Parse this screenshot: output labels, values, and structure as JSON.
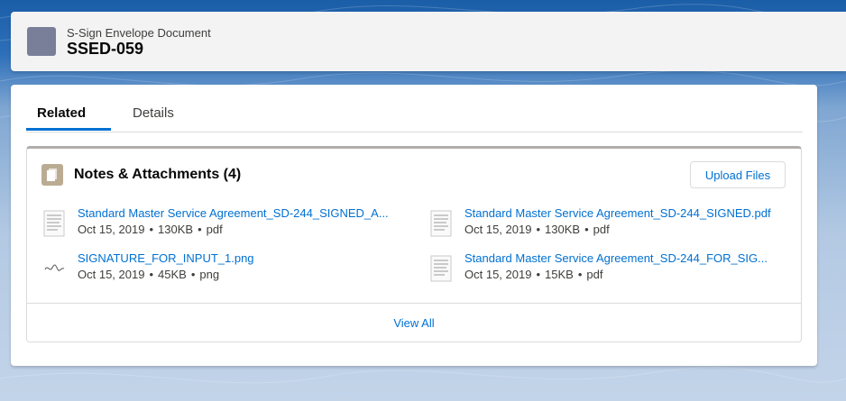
{
  "header": {
    "object_label": "S-Sign Envelope Document",
    "record_name": "SSED-059"
  },
  "tabs": [
    {
      "label": "Related",
      "active": true
    },
    {
      "label": "Details",
      "active": false
    }
  ],
  "notes_attachments": {
    "title": "Notes & Attachments (4)",
    "upload_label": "Upload Files",
    "view_all_label": "View All",
    "files": [
      {
        "name": "Standard Master Service Agreement_SD-244_SIGNED_A...",
        "date": "Oct 15, 2019",
        "size": "130KB",
        "type": "pdf",
        "thumb_icon": "pdf-document-thumbnail"
      },
      {
        "name": "Standard Master Service Agreement_SD-244_SIGNED.pdf",
        "date": "Oct 15, 2019",
        "size": "130KB",
        "type": "pdf",
        "thumb_icon": "pdf-document-thumbnail"
      },
      {
        "name": "SIGNATURE_FOR_INPUT_1.png",
        "date": "Oct 15, 2019",
        "size": "45KB",
        "type": "png",
        "thumb_icon": "signature-image-thumbnail"
      },
      {
        "name": "Standard Master Service Agreement_SD-244_FOR_SIG...",
        "date": "Oct 15, 2019",
        "size": "15KB",
        "type": "pdf",
        "thumb_icon": "pdf-document-thumbnail"
      }
    ]
  },
  "colors": {
    "link": "#0070d2",
    "tab_active_underline": "#0070d2",
    "object_icon": "#7a7f99",
    "notes_icon": "#baac93"
  }
}
